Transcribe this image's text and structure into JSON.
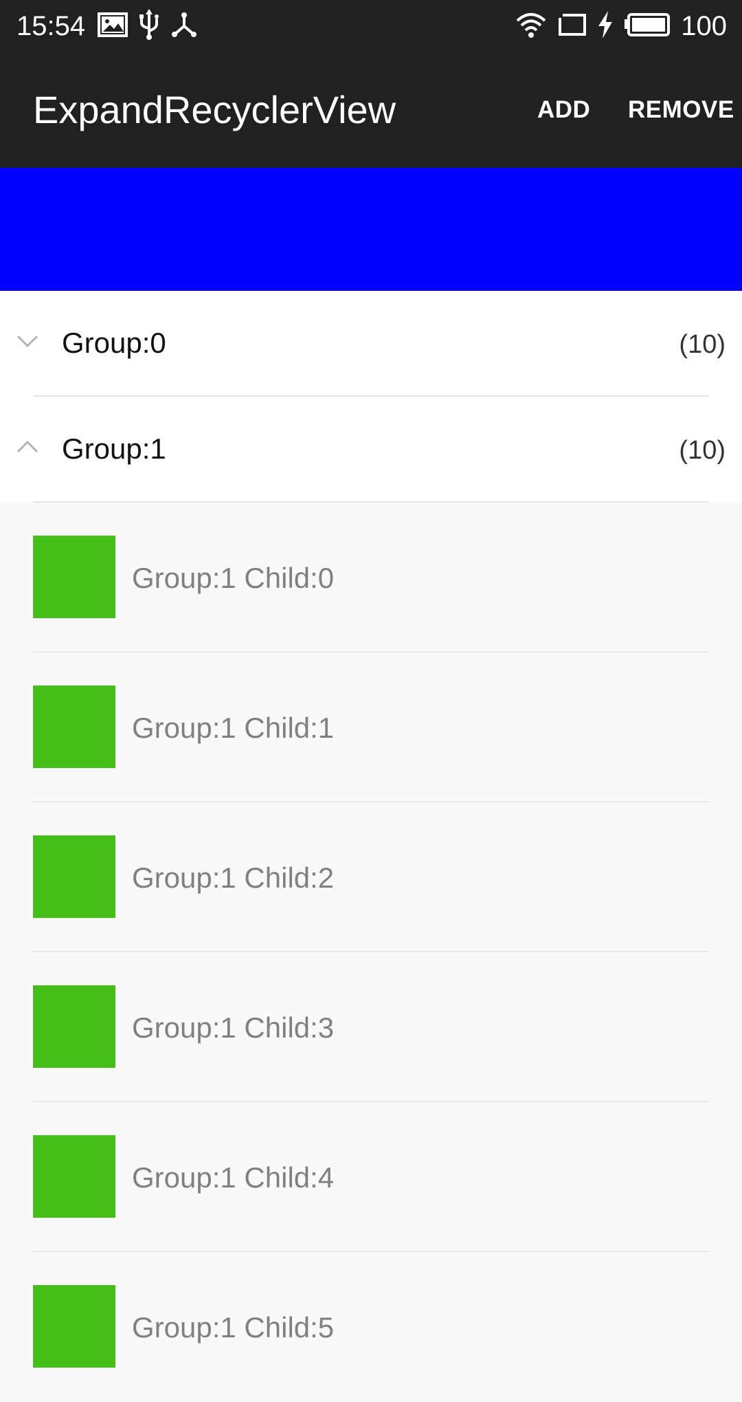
{
  "status_bar": {
    "time": "15:54",
    "left_icons": [
      "image-icon",
      "usb-icon",
      "share-icon"
    ],
    "right_icons": [
      "wifi-icon",
      "cast-icon",
      "charging-bolt-icon",
      "battery-icon"
    ],
    "battery_level": "100"
  },
  "app_bar": {
    "title": "ExpandRecyclerView",
    "actions": {
      "add": "ADD",
      "remove": "REMOVE"
    }
  },
  "colors": {
    "app_bar": "#212121",
    "banner": "#0000ff",
    "child_thumb": "#44bf18",
    "child_text": "#808080"
  },
  "groups": [
    {
      "title": "Group:0",
      "count": "(10)",
      "expanded": false,
      "icon": "chevron-down-icon"
    },
    {
      "title": "Group:1",
      "count": "(10)",
      "expanded": true,
      "icon": "chevron-up-icon"
    }
  ],
  "children": [
    {
      "title": "Group:1 Child:0"
    },
    {
      "title": "Group:1 Child:1"
    },
    {
      "title": "Group:1 Child:2"
    },
    {
      "title": "Group:1 Child:3"
    },
    {
      "title": "Group:1 Child:4"
    },
    {
      "title": "Group:1 Child:5"
    }
  ]
}
